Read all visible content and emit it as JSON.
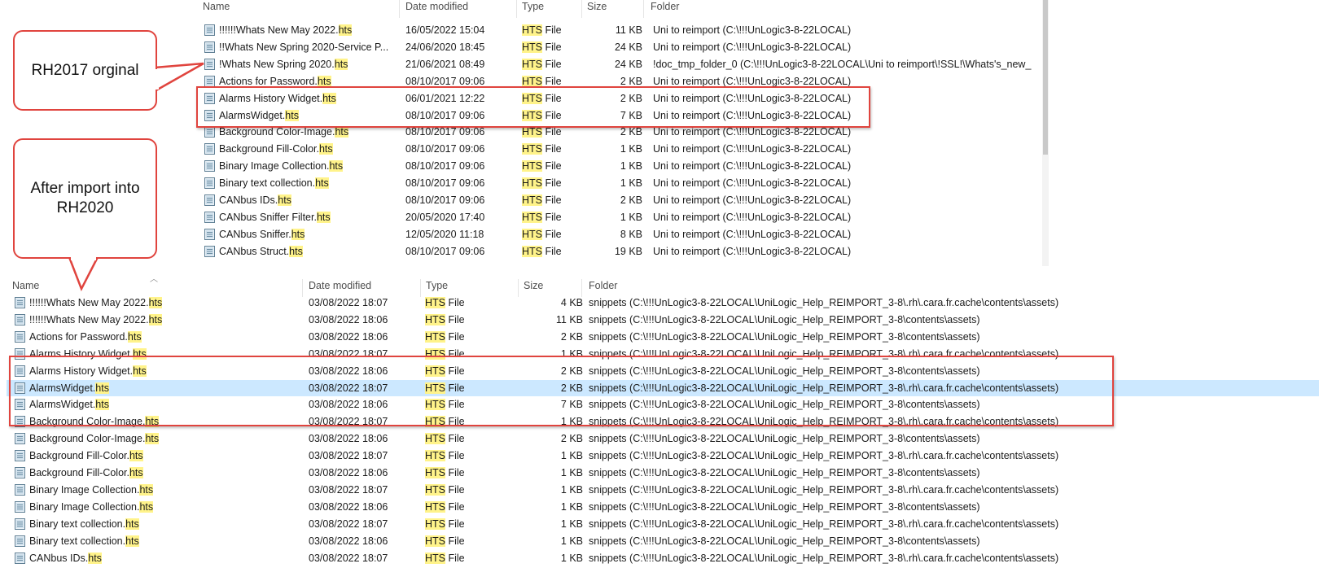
{
  "headers": {
    "name": "Name",
    "date": "Date modified",
    "type": "Type",
    "size": "Size",
    "folder": "Folder"
  },
  "callouts": {
    "top": {
      "text": "RH2017 orginal"
    },
    "bottom": {
      "line1": "After import into",
      "line2": "RH2020"
    }
  },
  "top_rows": [
    {
      "base": "!!!!!!Whats New May 2022.",
      "ext": "hts",
      "date": "16/05/2022 15:04",
      "type_hl": "HTS",
      "type_rest": " File",
      "size": "11 KB",
      "folder": "Uni to reimport (C:\\!!!UnLogic3-8-22LOCAL)"
    },
    {
      "base": "!!Whats New Spring 2020-Service P...",
      "ext": "",
      "date": "24/06/2020 18:45",
      "type_hl": "HTS",
      "type_rest": " File",
      "size": "24 KB",
      "folder": "Uni to reimport (C:\\!!!UnLogic3-8-22LOCAL)"
    },
    {
      "base": "!Whats New Spring 2020.",
      "ext": "hts",
      "date": "21/06/2021 08:49",
      "type_hl": "HTS",
      "type_rest": " File",
      "size": "24 KB",
      "folder": "!doc_tmp_folder_0 (C:\\!!!UnLogic3-8-22LOCAL\\Uni to reimport\\!SSL!\\Whats's_new_"
    },
    {
      "base": "Actions for Password.",
      "ext": "hts",
      "date": "08/10/2017 09:06",
      "type_hl": "HTS",
      "type_rest": " File",
      "size": "2 KB",
      "folder": "Uni to reimport (C:\\!!!UnLogic3-8-22LOCAL)"
    },
    {
      "base": "Alarms History Widget.",
      "ext": "hts",
      "date": "06/01/2021 12:22",
      "type_hl": "HTS",
      "type_rest": " File",
      "size": "2 KB",
      "folder": "Uni to reimport (C:\\!!!UnLogic3-8-22LOCAL)"
    },
    {
      "base": "AlarmsWidget.",
      "ext": "hts",
      "date": "08/10/2017 09:06",
      "type_hl": "HTS",
      "type_rest": " File",
      "size": "7 KB",
      "folder": "Uni to reimport (C:\\!!!UnLogic3-8-22LOCAL)"
    },
    {
      "base": "Background Color-Image.",
      "ext": "hts",
      "date": "08/10/2017 09:06",
      "type_hl": "HTS",
      "type_rest": " File",
      "size": "2 KB",
      "folder": "Uni to reimport (C:\\!!!UnLogic3-8-22LOCAL)"
    },
    {
      "base": "Background Fill-Color.",
      "ext": "hts",
      "date": "08/10/2017 09:06",
      "type_hl": "HTS",
      "type_rest": " File",
      "size": "1 KB",
      "folder": "Uni to reimport (C:\\!!!UnLogic3-8-22LOCAL)"
    },
    {
      "base": "Binary Image Collection.",
      "ext": "hts",
      "date": "08/10/2017 09:06",
      "type_hl": "HTS",
      "type_rest": " File",
      "size": "1 KB",
      "folder": "Uni to reimport (C:\\!!!UnLogic3-8-22LOCAL)"
    },
    {
      "base": "Binary text collection.",
      "ext": "hts",
      "date": "08/10/2017 09:06",
      "type_hl": "HTS",
      "type_rest": " File",
      "size": "1 KB",
      "folder": "Uni to reimport (C:\\!!!UnLogic3-8-22LOCAL)"
    },
    {
      "base": "CANbus IDs.",
      "ext": "hts",
      "date": "08/10/2017 09:06",
      "type_hl": "HTS",
      "type_rest": " File",
      "size": "2 KB",
      "folder": "Uni to reimport (C:\\!!!UnLogic3-8-22LOCAL)"
    },
    {
      "base": "CANbus Sniffer Filter.",
      "ext": "hts",
      "date": "20/05/2020 17:40",
      "type_hl": "HTS",
      "type_rest": " File",
      "size": "1 KB",
      "folder": "Uni to reimport (C:\\!!!UnLogic3-8-22LOCAL)"
    },
    {
      "base": "CANbus Sniffer.",
      "ext": "hts",
      "date": "12/05/2020 11:18",
      "type_hl": "HTS",
      "type_rest": " File",
      "size": "8 KB",
      "folder": "Uni to reimport (C:\\!!!UnLogic3-8-22LOCAL)"
    },
    {
      "base": "CANbus Struct.",
      "ext": "hts",
      "date": "08/10/2017 09:06",
      "type_hl": "HTS",
      "type_rest": " File",
      "size": "19 KB",
      "folder": "Uni to reimport (C:\\!!!UnLogic3-8-22LOCAL)"
    }
  ],
  "bottom_rows": [
    {
      "base": "!!!!!!Whats New May 2022.",
      "ext": "hts",
      "date": "03/08/2022 18:07",
      "type_hl": "HTS",
      "type_rest": " File",
      "size": "4 KB",
      "folder": "snippets (C:\\!!!UnLogic3-8-22LOCAL\\UniLogic_Help_REIMPORT_3-8\\.rh\\.cara.fr.cache\\contents\\assets)",
      "selected": false
    },
    {
      "base": "!!!!!!Whats New May 2022.",
      "ext": "hts",
      "date": "03/08/2022 18:06",
      "type_hl": "HTS",
      "type_rest": " File",
      "size": "11 KB",
      "folder": "snippets (C:\\!!!UnLogic3-8-22LOCAL\\UniLogic_Help_REIMPORT_3-8\\contents\\assets)",
      "selected": false
    },
    {
      "base": "Actions for Password.",
      "ext": "hts",
      "date": "03/08/2022 18:06",
      "type_hl": "HTS",
      "type_rest": " File",
      "size": "2 KB",
      "folder": "snippets (C:\\!!!UnLogic3-8-22LOCAL\\UniLogic_Help_REIMPORT_3-8\\contents\\assets)",
      "selected": false
    },
    {
      "base": "Alarms History Widget.",
      "ext": "hts",
      "date": "03/08/2022 18:07",
      "type_hl": "HTS",
      "type_rest": " File",
      "size": "1 KB",
      "folder": "snippets (C:\\!!!UnLogic3-8-22LOCAL\\UniLogic_Help_REIMPORT_3-8\\.rh\\.cara.fr.cache\\contents\\assets)",
      "selected": false
    },
    {
      "base": "Alarms History Widget.",
      "ext": "hts",
      "date": "03/08/2022 18:06",
      "type_hl": "HTS",
      "type_rest": " File",
      "size": "2 KB",
      "folder": "snippets (C:\\!!!UnLogic3-8-22LOCAL\\UniLogic_Help_REIMPORT_3-8\\contents\\assets)",
      "selected": false
    },
    {
      "base": "AlarmsWidget.",
      "ext": "hts",
      "date": "03/08/2022 18:07",
      "type_hl": "HTS",
      "type_rest": " File",
      "size": "2 KB",
      "folder": "snippets (C:\\!!!UnLogic3-8-22LOCAL\\UniLogic_Help_REIMPORT_3-8\\.rh\\.cara.fr.cache\\contents\\assets)",
      "selected": true
    },
    {
      "base": "AlarmsWidget.",
      "ext": "hts",
      "date": "03/08/2022 18:06",
      "type_hl": "HTS",
      "type_rest": " File",
      "size": "7 KB",
      "folder": "snippets (C:\\!!!UnLogic3-8-22LOCAL\\UniLogic_Help_REIMPORT_3-8\\contents\\assets)",
      "selected": false
    },
    {
      "base": "Background Color-Image.",
      "ext": "hts",
      "date": "03/08/2022 18:07",
      "type_hl": "HTS",
      "type_rest": " File",
      "size": "1 KB",
      "folder": "snippets (C:\\!!!UnLogic3-8-22LOCAL\\UniLogic_Help_REIMPORT_3-8\\.rh\\.cara.fr.cache\\contents\\assets)",
      "selected": false
    },
    {
      "base": "Background Color-Image.",
      "ext": "hts",
      "date": "03/08/2022 18:06",
      "type_hl": "HTS",
      "type_rest": " File",
      "size": "2 KB",
      "folder": "snippets (C:\\!!!UnLogic3-8-22LOCAL\\UniLogic_Help_REIMPORT_3-8\\contents\\assets)",
      "selected": false
    },
    {
      "base": "Background Fill-Color.",
      "ext": "hts",
      "date": "03/08/2022 18:07",
      "type_hl": "HTS",
      "type_rest": " File",
      "size": "1 KB",
      "folder": "snippets (C:\\!!!UnLogic3-8-22LOCAL\\UniLogic_Help_REIMPORT_3-8\\.rh\\.cara.fr.cache\\contents\\assets)",
      "selected": false
    },
    {
      "base": "Background Fill-Color.",
      "ext": "hts",
      "date": "03/08/2022 18:06",
      "type_hl": "HTS",
      "type_rest": " File",
      "size": "1 KB",
      "folder": "snippets (C:\\!!!UnLogic3-8-22LOCAL\\UniLogic_Help_REIMPORT_3-8\\contents\\assets)",
      "selected": false
    },
    {
      "base": "Binary Image Collection.",
      "ext": "hts",
      "date": "03/08/2022 18:07",
      "type_hl": "HTS",
      "type_rest": " File",
      "size": "1 KB",
      "folder": "snippets (C:\\!!!UnLogic3-8-22LOCAL\\UniLogic_Help_REIMPORT_3-8\\.rh\\.cara.fr.cache\\contents\\assets)",
      "selected": false
    },
    {
      "base": "Binary Image Collection.",
      "ext": "hts",
      "date": "03/08/2022 18:06",
      "type_hl": "HTS",
      "type_rest": " File",
      "size": "1 KB",
      "folder": "snippets (C:\\!!!UnLogic3-8-22LOCAL\\UniLogic_Help_REIMPORT_3-8\\contents\\assets)",
      "selected": false
    },
    {
      "base": "Binary text collection.",
      "ext": "hts",
      "date": "03/08/2022 18:07",
      "type_hl": "HTS",
      "type_rest": " File",
      "size": "1 KB",
      "folder": "snippets (C:\\!!!UnLogic3-8-22LOCAL\\UniLogic_Help_REIMPORT_3-8\\.rh\\.cara.fr.cache\\contents\\assets)",
      "selected": false
    },
    {
      "base": "Binary text collection.",
      "ext": "hts",
      "date": "03/08/2022 18:06",
      "type_hl": "HTS",
      "type_rest": " File",
      "size": "1 KB",
      "folder": "snippets (C:\\!!!UnLogic3-8-22LOCAL\\UniLogic_Help_REIMPORT_3-8\\contents\\assets)",
      "selected": false
    },
    {
      "base": "CANbus IDs.",
      "ext": "hts",
      "date": "03/08/2022 18:07",
      "type_hl": "HTS",
      "type_rest": " File",
      "size": "1 KB",
      "folder": "snippets (C:\\!!!UnLogic3-8-22LOCAL\\UniLogic_Help_REIMPORT_3-8\\.rh\\.cara.fr.cache\\contents\\assets)",
      "selected": false
    }
  ],
  "colors": {
    "highlight": "#fff38a",
    "selection": "#cce8ff",
    "annotation_red": "#e0443e"
  },
  "icons": {
    "file": "file-icon",
    "sort": "sort-up-icon"
  }
}
